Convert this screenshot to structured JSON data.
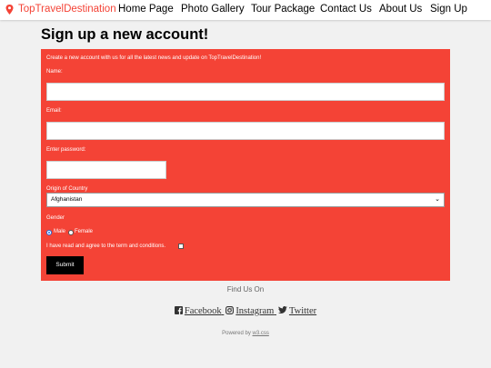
{
  "nav": {
    "brand": "TopTravelDestination",
    "links": [
      "Home Page",
      "Photo Gallery",
      "Tour Package",
      "Contact Us",
      "About Us",
      "Sign Up"
    ]
  },
  "page": {
    "title": "Sign up a new account!"
  },
  "form": {
    "intro": "Create a new account with us for all the latest news and update on TopTravelDestination!",
    "name_label": "Name:",
    "email_label": "Email:",
    "password_label": "Enter password:",
    "country_label": "Origin of Country",
    "country_selected": "Afghanistan",
    "gender_label": "Gender",
    "gender_options": [
      "Male",
      "Female"
    ],
    "gender_selected": "Male",
    "terms_label": "I have read and agree to the term and conditions.",
    "terms_checked": false,
    "submit_label": "Submit"
  },
  "footer": {
    "find_us": "Find Us On",
    "social": [
      "Facebook",
      "Instagram",
      "Twitter"
    ],
    "powered_prefix": "Powered by",
    "powered_link": "w3.css"
  },
  "colors": {
    "accent": "#f44336",
    "submit": "#000000",
    "background": "#f1f1f1"
  },
  "icons": [
    "map-marker-icon",
    "facebook-icon",
    "instagram-icon",
    "twitter-icon",
    "chevron-down-icon"
  ]
}
